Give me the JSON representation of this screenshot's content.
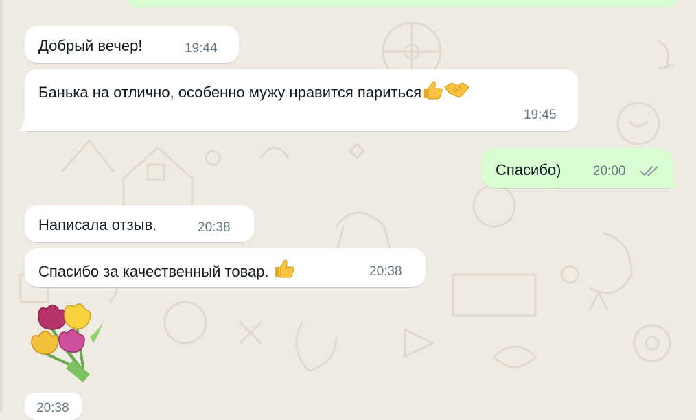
{
  "chat": {
    "messages": [
      {
        "direction": "in",
        "text": "Добрый вечер!",
        "time": "19:44"
      },
      {
        "direction": "in",
        "text": "Банька на отлично, особенно мужу нравится париться",
        "emojis": [
          "thumbs-up",
          "handshake"
        ],
        "time": "19:45"
      },
      {
        "direction": "out",
        "text": "Спасибо)",
        "time": "20:00",
        "status": "read-double-check"
      },
      {
        "direction": "in",
        "text": "Написала отзыв.",
        "time": "20:38"
      },
      {
        "direction": "in",
        "text": "Спасибо за качественный товар.",
        "emojis": [
          "thumbs-up"
        ],
        "time": "20:38"
      },
      {
        "direction": "in",
        "sticker": "tulip-bouquet",
        "time": "20:38"
      }
    ]
  },
  "colors": {
    "wallpaper": "#efeae2",
    "incoming_bubble": "#ffffff",
    "outgoing_bubble": "#d9fdd3",
    "timestamp": "#667781",
    "read_check": "#8696a0"
  }
}
